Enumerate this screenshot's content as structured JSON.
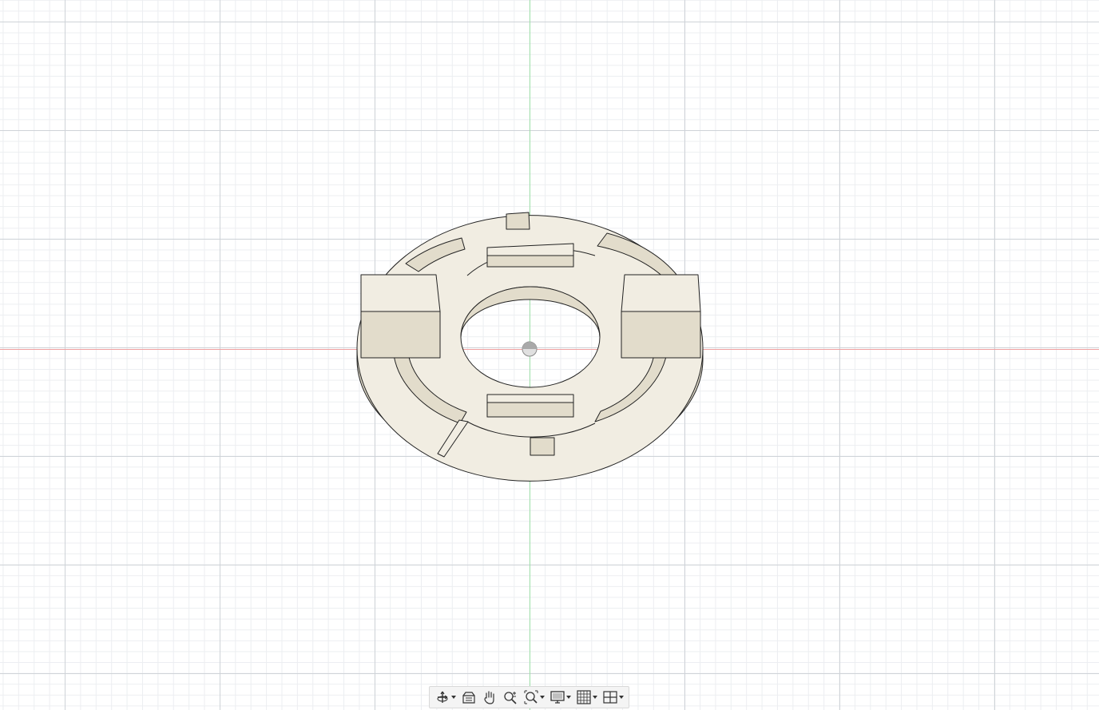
{
  "viewport": {
    "background": "#ffffff",
    "x_axis_color": "#f0a0a0",
    "y_axis_color": "#9ee0a8"
  },
  "model": {
    "body_color": "#f1ede2",
    "side_color": "#e2dccb",
    "edge_color": "#222222"
  },
  "toolbar": {
    "items": [
      {
        "icon": "orbit-icon",
        "has_dropdown": true
      },
      {
        "icon": "look-at-icon",
        "has_dropdown": false
      },
      {
        "icon": "pan-icon",
        "has_dropdown": false
      },
      {
        "icon": "zoom-icon",
        "has_dropdown": false
      },
      {
        "icon": "fit-icon",
        "has_dropdown": true
      },
      {
        "icon": "display-settings-icon",
        "has_dropdown": true
      },
      {
        "icon": "grid-snaps-icon",
        "has_dropdown": true
      },
      {
        "icon": "viewports-icon",
        "has_dropdown": true
      }
    ]
  }
}
